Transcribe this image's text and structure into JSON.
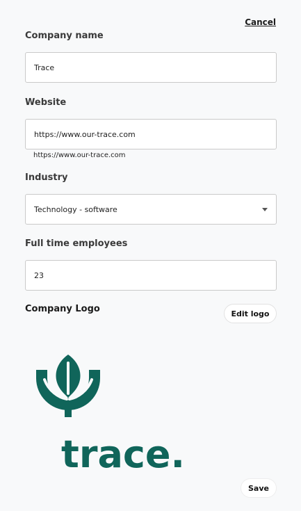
{
  "header": {
    "cancel_label": "Cancel"
  },
  "form": {
    "company_name": {
      "label": "Company name",
      "value": "Trace"
    },
    "website": {
      "label": "Website",
      "value": "https://www.our-trace.com",
      "helper": "https://www.our-trace.com"
    },
    "industry": {
      "label": "Industry",
      "value": "Technology - software"
    },
    "employees": {
      "label": "Full time employees",
      "value": "23"
    }
  },
  "logo_section": {
    "title": "Company Logo",
    "edit_label": "Edit logo",
    "logo_icon": "trace-leaf-logo",
    "logo_text": "trace.",
    "brand_color": "#10655a"
  },
  "footer": {
    "save_label": "Save"
  }
}
